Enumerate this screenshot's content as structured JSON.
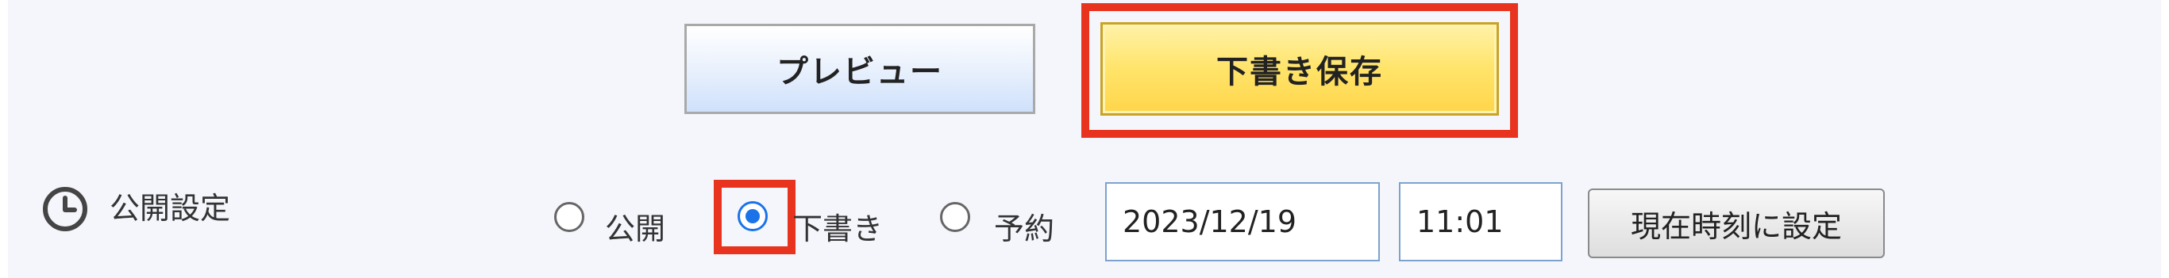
{
  "buttons": {
    "preview_label": "プレビュー",
    "save_draft_label": "下書き保存",
    "set_now_label": "現在時刻に設定"
  },
  "publish_setting": {
    "label": "公開設定",
    "options": [
      {
        "label": "公開",
        "checked": false
      },
      {
        "label": "下書き",
        "checked": true
      },
      {
        "label": "予約",
        "checked": false
      }
    ],
    "date_value": "2023/12/19",
    "time_value": "11:01"
  },
  "colors": {
    "highlight": "#e8341f",
    "draft_button": "#ffe46a",
    "radio_selected": "#1a73e8"
  },
  "icons": {
    "publish_setting": "clock-icon"
  }
}
